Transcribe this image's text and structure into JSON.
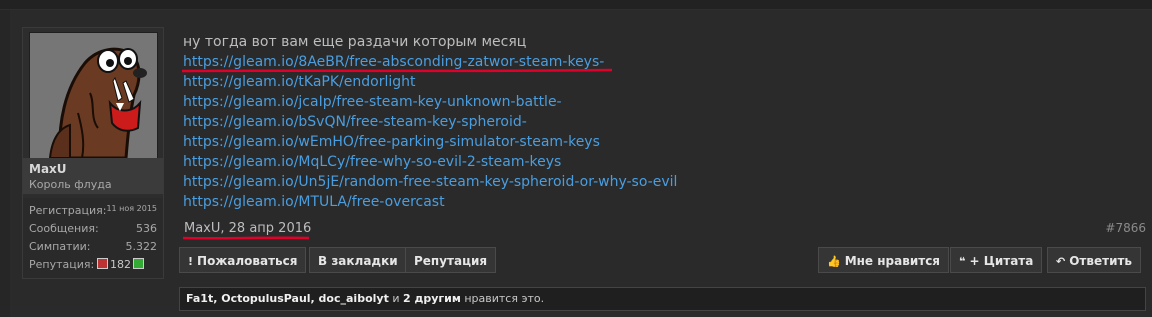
{
  "user": {
    "name": "MaxU",
    "title": "Король флуда",
    "stats": [
      {
        "label": "Регистрация:",
        "value": "11 ноя 2015"
      },
      {
        "label": "Сообщения:",
        "value": "536"
      },
      {
        "label": "Симпатии:",
        "value": "5.322"
      },
      {
        "label": "Репутация:",
        "value": "182"
      }
    ]
  },
  "post": {
    "intro": "ну тогда вот вам еще раздачи которым месяц",
    "links": [
      "https://gleam.io/8AeBR/free-absconding-zatwor-steam-keys-",
      "https://gleam.io/tKaPK/endorlight",
      "https://gleam.io/jcaIp/free-steam-key-unknown-battle-",
      "https://gleam.io/bSvQN/free-steam-key-spheroid-",
      "https://gleam.io/wEmHO/free-parking-simulator-steam-keys",
      "https://gleam.io/MqLCy/free-why-so-evil-2-steam-keys",
      "https://gleam.io/Un5jE/random-free-steam-key-spheroid-or-why-so-evil",
      "https://gleam.io/MTULA/free-overcast"
    ],
    "author_date": "MaxU, 28 апр 2016",
    "number": "#7866"
  },
  "actions": {
    "report": "Пожаловаться",
    "bookmark": "В закладки",
    "reputation": "Репутация",
    "like": "Мне нравится",
    "quote": "+ Цитата",
    "reply": "Ответить"
  },
  "likes": {
    "names": "Fa1t, OctopulusPaul, doc_aibolyt",
    "connector": " и ",
    "others": "2 другим",
    "suffix": " нравится это."
  },
  "colors": {
    "link": "#4a9ee0",
    "annotation": "#e0002a"
  }
}
